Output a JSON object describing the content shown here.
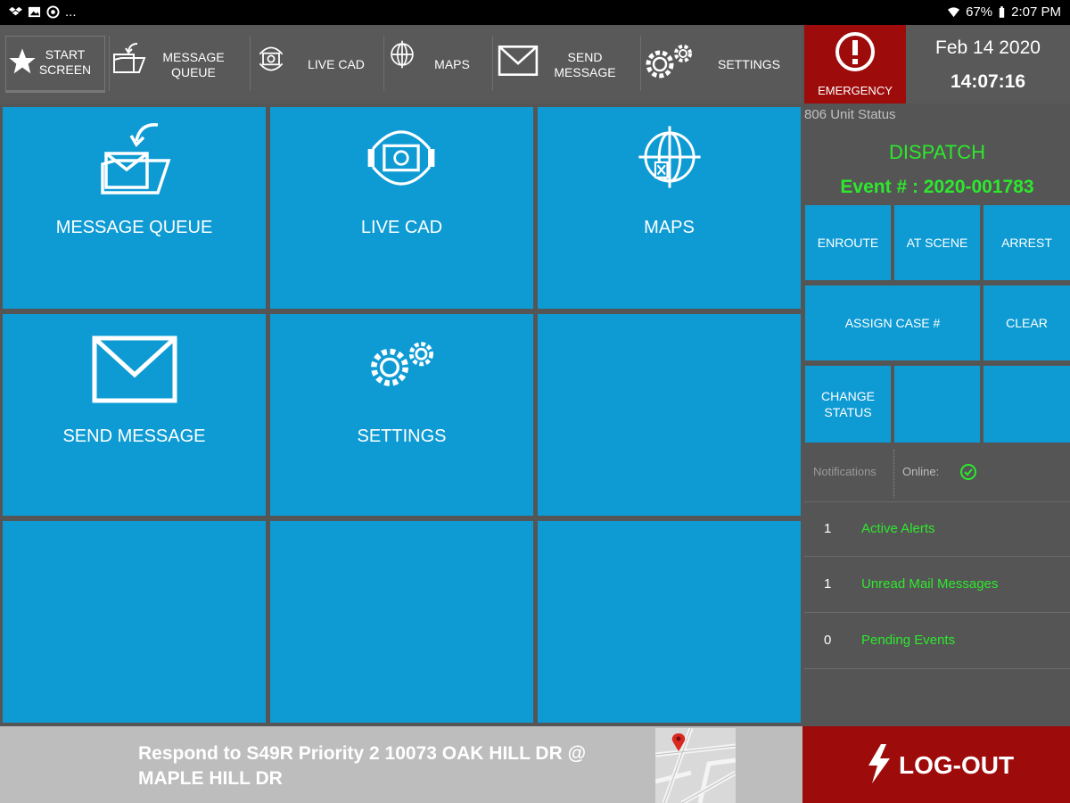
{
  "status_bar": {
    "left_icons": [
      "dropbox-icon",
      "image-icon",
      "vpn-icon"
    ],
    "overflow": "...",
    "battery": "67%",
    "time": "2:07 PM"
  },
  "toolbar": {
    "start_screen": "START\nSCREEN",
    "message_queue": "MESSAGE\nQUEUE",
    "live_cad": "LIVE CAD",
    "maps": "MAPS",
    "send_message": "SEND\nMESSAGE",
    "settings": "SETTINGS"
  },
  "emergency": {
    "label": "EMERGENCY"
  },
  "clock": {
    "date": "Feb 14 2020",
    "time": "14:07:16"
  },
  "tiles": {
    "message_queue": "MESSAGE QUEUE",
    "live_cad": "LIVE CAD",
    "maps": "MAPS",
    "send_message": "SEND MESSAGE",
    "settings": "SETTINGS"
  },
  "unit_panel": {
    "title": "806  Unit Status",
    "status": "DISPATCH",
    "event": "Event # : 2020-001783",
    "buttons": {
      "enroute": "ENROUTE",
      "at_scene": "AT SCENE",
      "arrest": "ARREST",
      "assign_case": "ASSIGN CASE #",
      "clear": "CLEAR",
      "change_status": "CHANGE\nSTATUS"
    },
    "notifications_label": "Notifications",
    "online_label": "Online:",
    "alerts": [
      {
        "count": "1",
        "name": "Active Alerts"
      },
      {
        "count": "1",
        "name": "Unread Mail Messages"
      },
      {
        "count": "0",
        "name": "Pending Events"
      }
    ]
  },
  "bottom": {
    "dispatch_message": "Respond to S49R  Priority 2   10073 OAK HILL DR  @ MAPLE HILL DR",
    "logout": "LOG-OUT"
  },
  "colors": {
    "tile_blue": "#0e9bd4",
    "emergency_red": "#9e0b0b",
    "status_green": "#2de82d",
    "panel_gray": "#555555"
  }
}
